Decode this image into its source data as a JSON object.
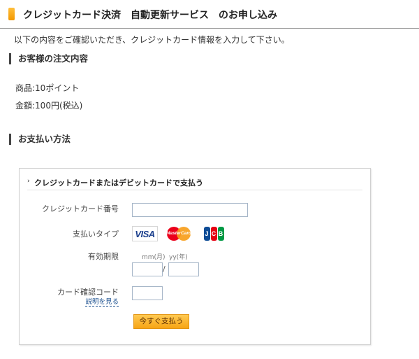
{
  "header": {
    "title": "クレジットカード決済　自動更新サービス　のお申し込み"
  },
  "intro_text": "以下の内容をご確認いただき、クレジットカード情報を入力して下さい。",
  "order": {
    "heading": "お客様の注文内容",
    "product": "商品:10ポイント",
    "amount": "金額:100円(税込)"
  },
  "payment": {
    "heading": "お支払い方法",
    "method_label": "クレジットカードまたはデビットカードで支払う",
    "card_number_label": "クレジットカード番号",
    "card_number_value": "",
    "pay_type_label": "支払いタイプ",
    "card_brands": [
      "VISA",
      "MasterCard",
      "JCB"
    ],
    "expiry_label": "有効期限",
    "expiry_month_hint": "mm(月)",
    "expiry_year_hint": "yy(年)",
    "expiry_separator": "/",
    "cvc_label": "カード確認コード",
    "cvc_help_link": "説明を見る",
    "submit_label": "今すぐ支払う"
  },
  "colors": {
    "accent_orange": "#f39800",
    "link_blue": "#1a4f8f",
    "visa_blue": "#1a3e8c",
    "mastercard_red": "#eb001b",
    "mastercard_yellow": "#f79e1b",
    "jcb_blue": "#0e4c96",
    "jcb_red": "#e60012",
    "jcb_green": "#009944"
  }
}
